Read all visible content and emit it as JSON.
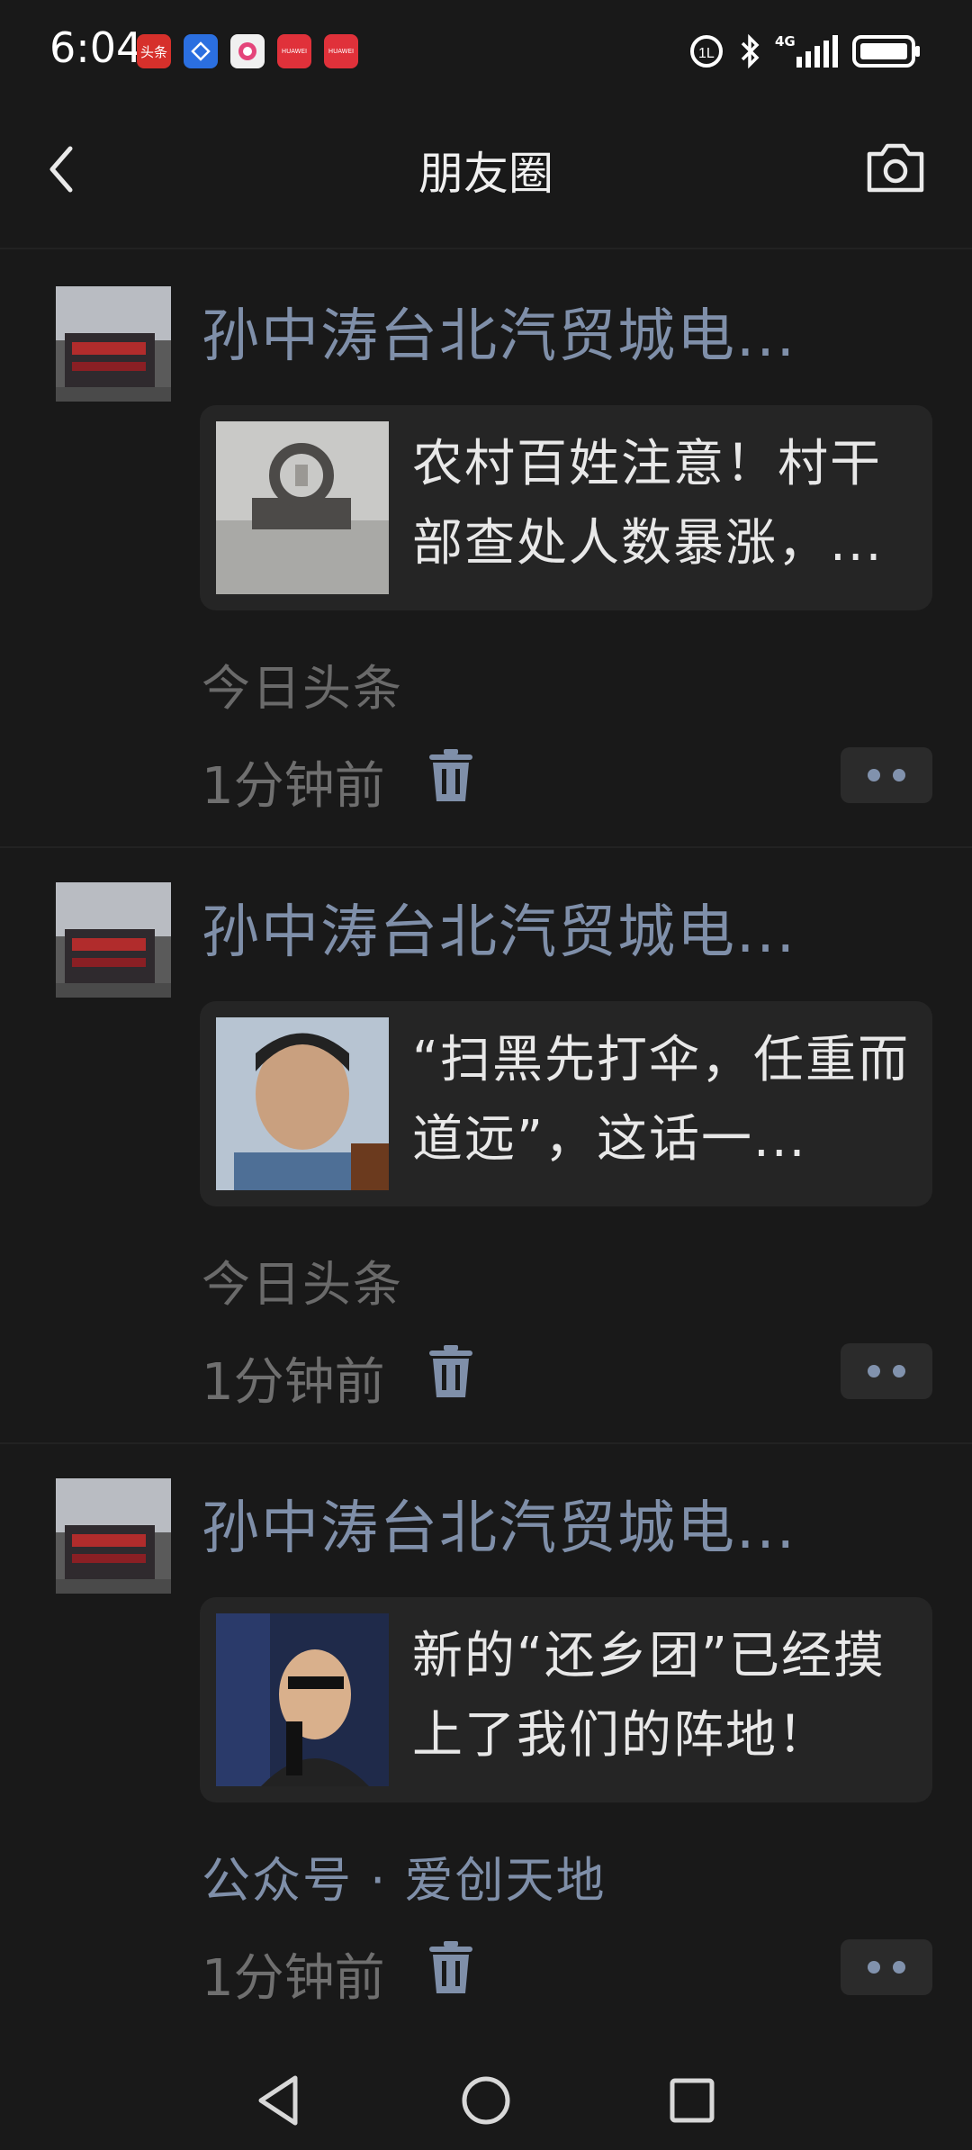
{
  "status_bar": {
    "time": "6:04",
    "notification_icons": [
      "头条",
      "toutiao-app-icon",
      "camera-app-icon",
      "HUAWEI",
      "HUAWEI"
    ],
    "network": "4G",
    "icons": [
      "hd-call-icon",
      "bluetooth-icon",
      "signal-icon",
      "battery-icon"
    ]
  },
  "header": {
    "title": "朋友圈",
    "back_icon": "chevron-left-icon",
    "camera_icon": "camera-icon"
  },
  "posts": [
    {
      "author": "孙中涛台北汽贸城电...",
      "card_text": "农村百姓注意！村干部查处人数暴涨，...",
      "source": "今日头条",
      "source_is_link": false,
      "time": "1分钟前"
    },
    {
      "author": "孙中涛台北汽贸城电...",
      "card_text": "“扫黑先打伞，任重而道远”，这话一...",
      "source": "今日头条",
      "source_is_link": false,
      "time": "1分钟前"
    },
    {
      "author": "孙中涛台北汽贸城电...",
      "card_text": "新的“还乡团”已经摸上了我们的阵地！",
      "source": "公众号 · 爱创天地",
      "source_is_link": true,
      "time": "1分钟前"
    }
  ],
  "nav_bar": {
    "icons": [
      "back-triangle-icon",
      "home-circle-icon",
      "recents-square-icon"
    ]
  },
  "colors": {
    "background": "#191919",
    "link": "#7f8fa9",
    "card": "#252525",
    "muted": "#6f6f6f"
  }
}
